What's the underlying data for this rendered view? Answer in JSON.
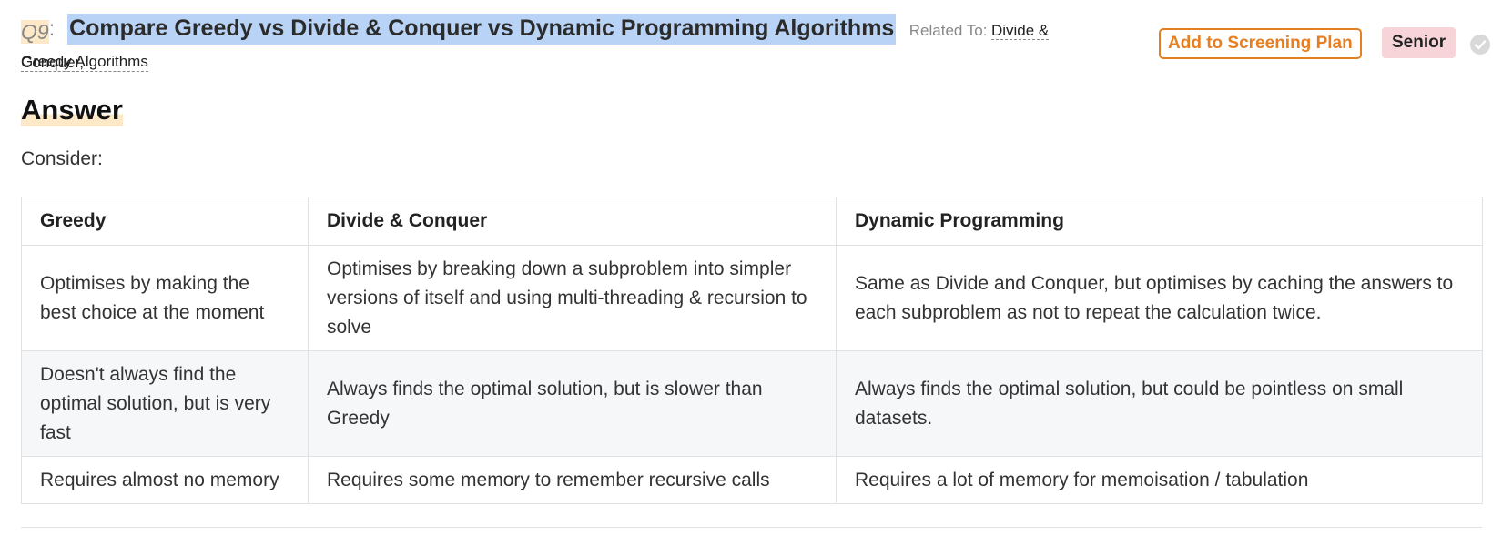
{
  "question": {
    "number": "Q9",
    "separator": ":",
    "title": "Compare Greedy vs Divide & Conquer vs Dynamic Programming Algorithms",
    "related_label": "Related To:",
    "related": [
      "Divide & Conquer,",
      "Greedy Algorithms"
    ]
  },
  "actions": {
    "add_to_plan": "Add to Screening Plan",
    "level_badge": "Senior",
    "check_icon": "check-circle-icon"
  },
  "answer": {
    "heading": "Answer",
    "intro": "Consider:"
  },
  "table": {
    "headers": [
      "Greedy",
      "Divide & Conquer",
      "Dynamic Programming"
    ],
    "rows": [
      [
        "Optimises by making the best choice at the moment",
        "Optimises by breaking down a subproblem into simpler versions of itself and using multi-threading & recursion to solve",
        "Same as Divide and Conquer, but optimises by caching the answers to each subproblem as not to repeat the calculation twice."
      ],
      [
        "Doesn't always find the optimal solution, but is very fast",
        "Always finds the optimal solution, but is slower than Greedy",
        "Always finds the optimal solution, but could be pointless on small datasets."
      ],
      [
        "Requires almost no memory",
        "Requires some memory to remember recursive calls",
        "Requires a lot of memory for memoisation / tabulation"
      ]
    ]
  },
  "colors": {
    "accent_orange": "#e67e22",
    "selection_blue": "#b8d3f5",
    "highlight_peach": "#fde8c8",
    "badge_pink": "#f7d4d8"
  }
}
